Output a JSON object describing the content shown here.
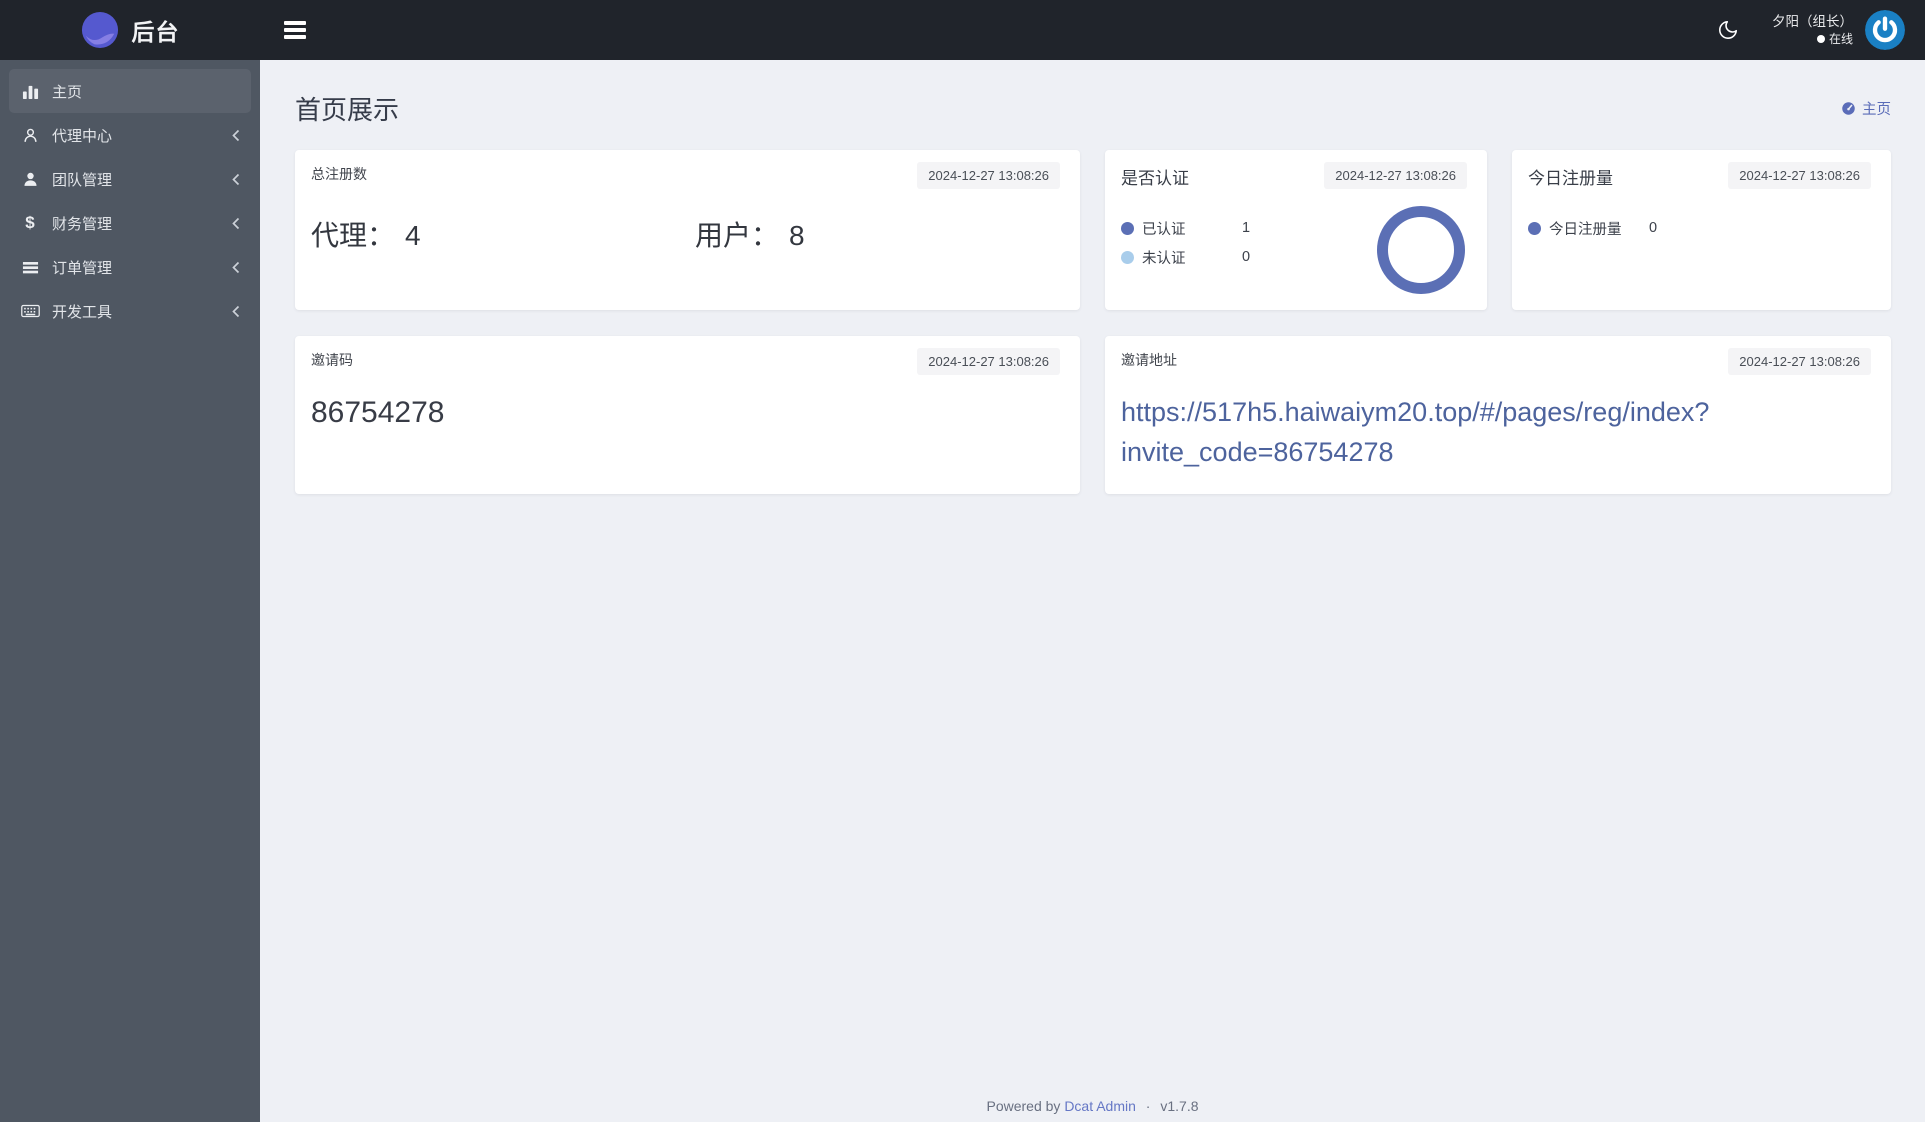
{
  "navbar": {
    "brand": "后台",
    "user": {
      "name": "夕阳（组长）",
      "status": "在线"
    }
  },
  "sidebar": {
    "items": [
      {
        "label": "主页",
        "icon": "bar-chart-icon",
        "active": true
      },
      {
        "label": "代理中心",
        "icon": "person-icon"
      },
      {
        "label": "团队管理",
        "icon": "team-icon"
      },
      {
        "label": "财务管理",
        "icon": "dollar-icon",
        "glyph": "$"
      },
      {
        "label": "订单管理",
        "icon": "list-icon"
      },
      {
        "label": "开发工具",
        "icon": "keyboard-icon"
      }
    ]
  },
  "page": {
    "title": "首页展示",
    "breadcrumb": "主页"
  },
  "cards": {
    "total": {
      "title": "总注册数",
      "timestamp": "2024-12-27 13:08:26",
      "agent_label": "代理：",
      "agent_value": "4",
      "user_label": "用户：",
      "user_value": "8"
    },
    "auth": {
      "title": "是否认证",
      "timestamp": "2024-12-27 13:08:26",
      "legend": [
        {
          "label": "已认证",
          "value": "1",
          "color": "#5b6fb5"
        },
        {
          "label": "未认证",
          "value": "0",
          "color": "#a9cdeb"
        }
      ],
      "donut": {
        "series": [
          1,
          0
        ],
        "color": "#5b6fb5"
      }
    },
    "today": {
      "title": "今日注册量",
      "timestamp": "2024-12-27 13:08:26",
      "legend": [
        {
          "label": "今日注册量",
          "value": "0",
          "color": "#5b6fb5"
        }
      ]
    },
    "invite_code": {
      "title": "邀请码",
      "timestamp": "2024-12-27 13:08:26",
      "value": "86754278"
    },
    "invite_url": {
      "title": "邀请地址",
      "timestamp": "2024-12-27 13:08:26",
      "url": "https://517h5.haiwaiym20.top/#/pages/reg/index?invite_code=86754278"
    }
  },
  "footer": {
    "powered": "Powered by",
    "link": "Dcat Admin",
    "sep": "·",
    "version": "v1.7.8"
  },
  "colors": {
    "primary": "#5b6fb5",
    "light_blue": "#a9cdeb",
    "avatar_blue": "#1a80c4",
    "logo_purple": "#5559cf",
    "navbar_bg": "#20242b",
    "sidebar_bg": "#4f5762",
    "content_bg": "#eef0f5"
  }
}
